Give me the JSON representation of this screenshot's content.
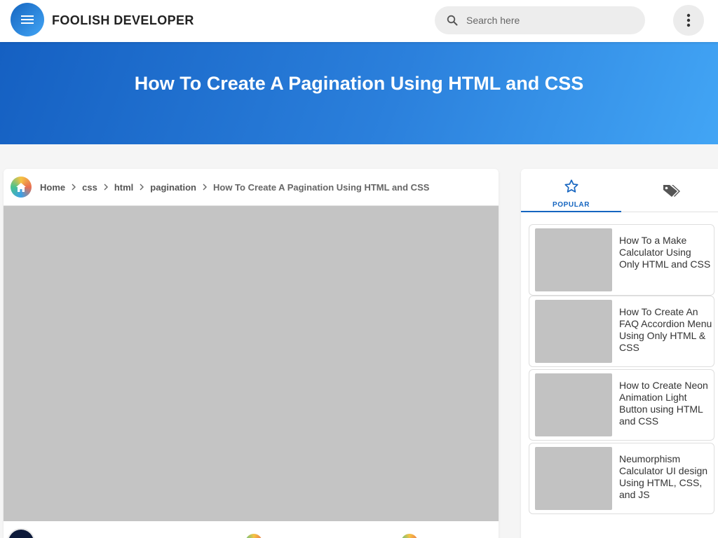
{
  "header": {
    "site_title": "FOOLISH DEVELOPER",
    "search_placeholder": "Search here",
    "icons": {
      "menu": "hamburger-menu-icon",
      "search": "search-icon",
      "more": "more-vertical-icon"
    }
  },
  "hero": {
    "title": "How To Create A Pagination Using HTML and CSS"
  },
  "breadcrumb": {
    "items": [
      "Home",
      "css",
      "html",
      "pagination"
    ],
    "current": "How To Create A Pagination Using HTML and CSS"
  },
  "sidebar": {
    "tabs": [
      {
        "label": "POPULAR",
        "icon": "star-icon",
        "active": true
      },
      {
        "label": "",
        "icon": "tags-icon",
        "active": false
      }
    ],
    "popular_posts": [
      {
        "title": "How To a Make Calculator Using Only HTML and CSS"
      },
      {
        "title": "How To Create An FAQ Accordion Menu Using Only HTML & CSS"
      },
      {
        "title": "How to Create Neon Animation Light Button using HTML and CSS"
      },
      {
        "title": "Neumorphism Calculator UI design Using HTML, CSS, and JS"
      }
    ]
  },
  "colors": {
    "accent": "#1565c0",
    "hero_gradient_start": "#1560c2",
    "hero_gradient_end": "#42a5f5",
    "placeholder_gray": "#c4c4c4"
  }
}
